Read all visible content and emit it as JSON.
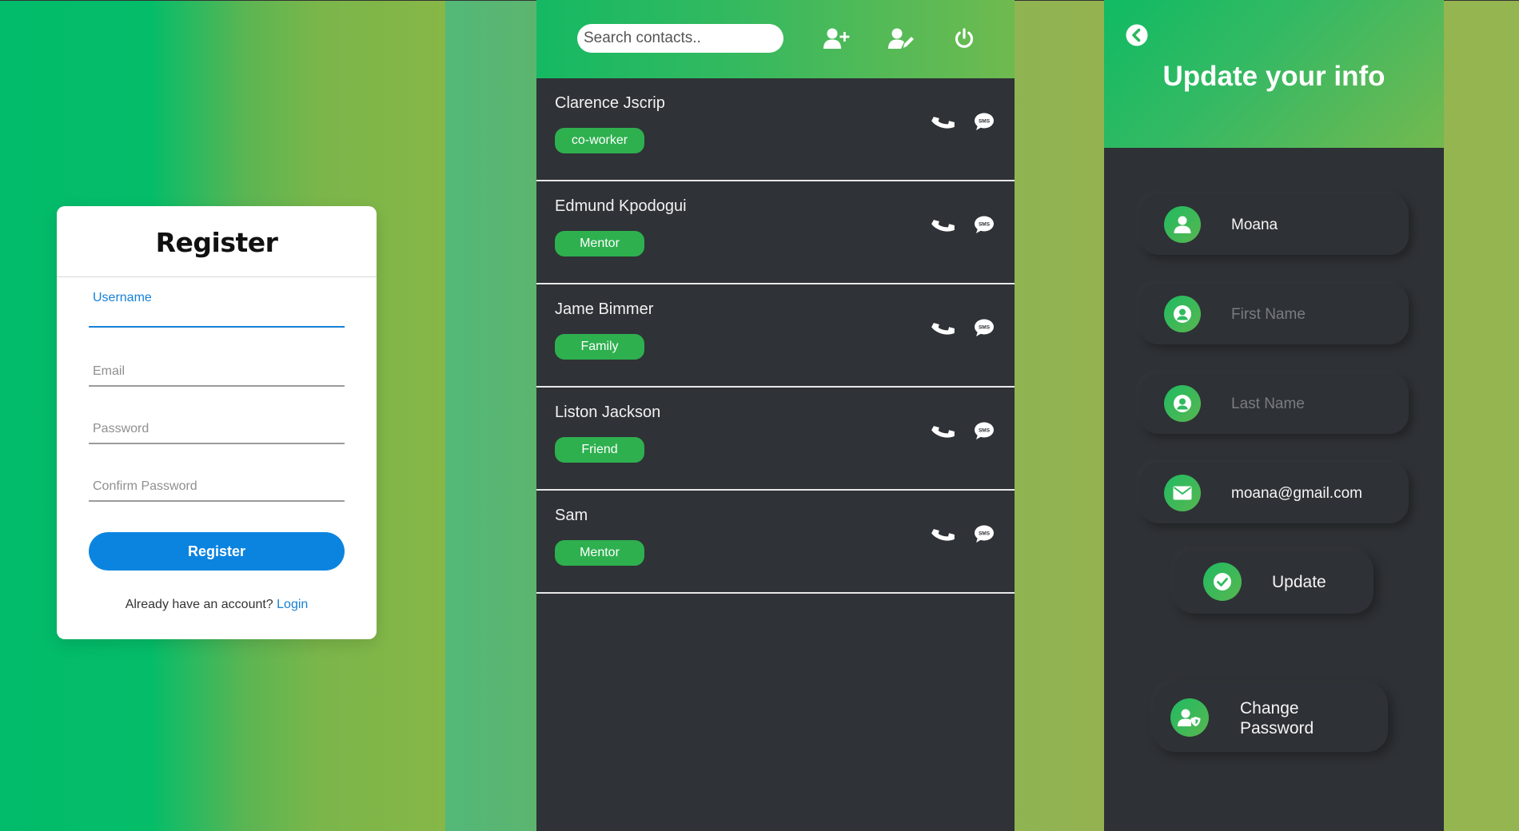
{
  "register": {
    "title": "Register",
    "fields": [
      {
        "label": "Username",
        "active": true
      },
      {
        "label": "Email",
        "active": false
      },
      {
        "label": "Password",
        "active": false
      },
      {
        "label": "Confirm Password",
        "active": false
      }
    ],
    "button_label": "Register",
    "footer_text": "Already have an account?",
    "footer_link": "Login"
  },
  "contacts_panel": {
    "search_placeholder": "Search contacts..",
    "header_icons": [
      "add-user-icon",
      "edit-user-icon",
      "power-icon"
    ],
    "contacts": [
      {
        "name": "Clarence Jscrip",
        "tag": "co-worker"
      },
      {
        "name": "Edmund Kpodogui",
        "tag": "Mentor"
      },
      {
        "name": "Jame Bimmer",
        "tag": "Family"
      },
      {
        "name": "Liston Jackson",
        "tag": "Friend"
      },
      {
        "name": "Sam",
        "tag": "Mentor"
      }
    ],
    "sms_icon_text": "SMS"
  },
  "update_panel": {
    "title": "Update your info",
    "fields": [
      {
        "icon": "user-icon",
        "value": "Moana",
        "placeholder": ""
      },
      {
        "icon": "user-circle-icon",
        "value": "",
        "placeholder": "First Name"
      },
      {
        "icon": "user-circle-icon",
        "value": "",
        "placeholder": "Last Name"
      },
      {
        "icon": "envelope-icon",
        "value": "moana@gmail.com",
        "placeholder": ""
      }
    ],
    "update_label": "Update",
    "change_password_line1": "Change",
    "change_password_line2": "Password"
  },
  "colors": {
    "accent_green": "#2eb04f",
    "accent_blue": "#0b84e0",
    "panel_dark": "#2f3236"
  }
}
